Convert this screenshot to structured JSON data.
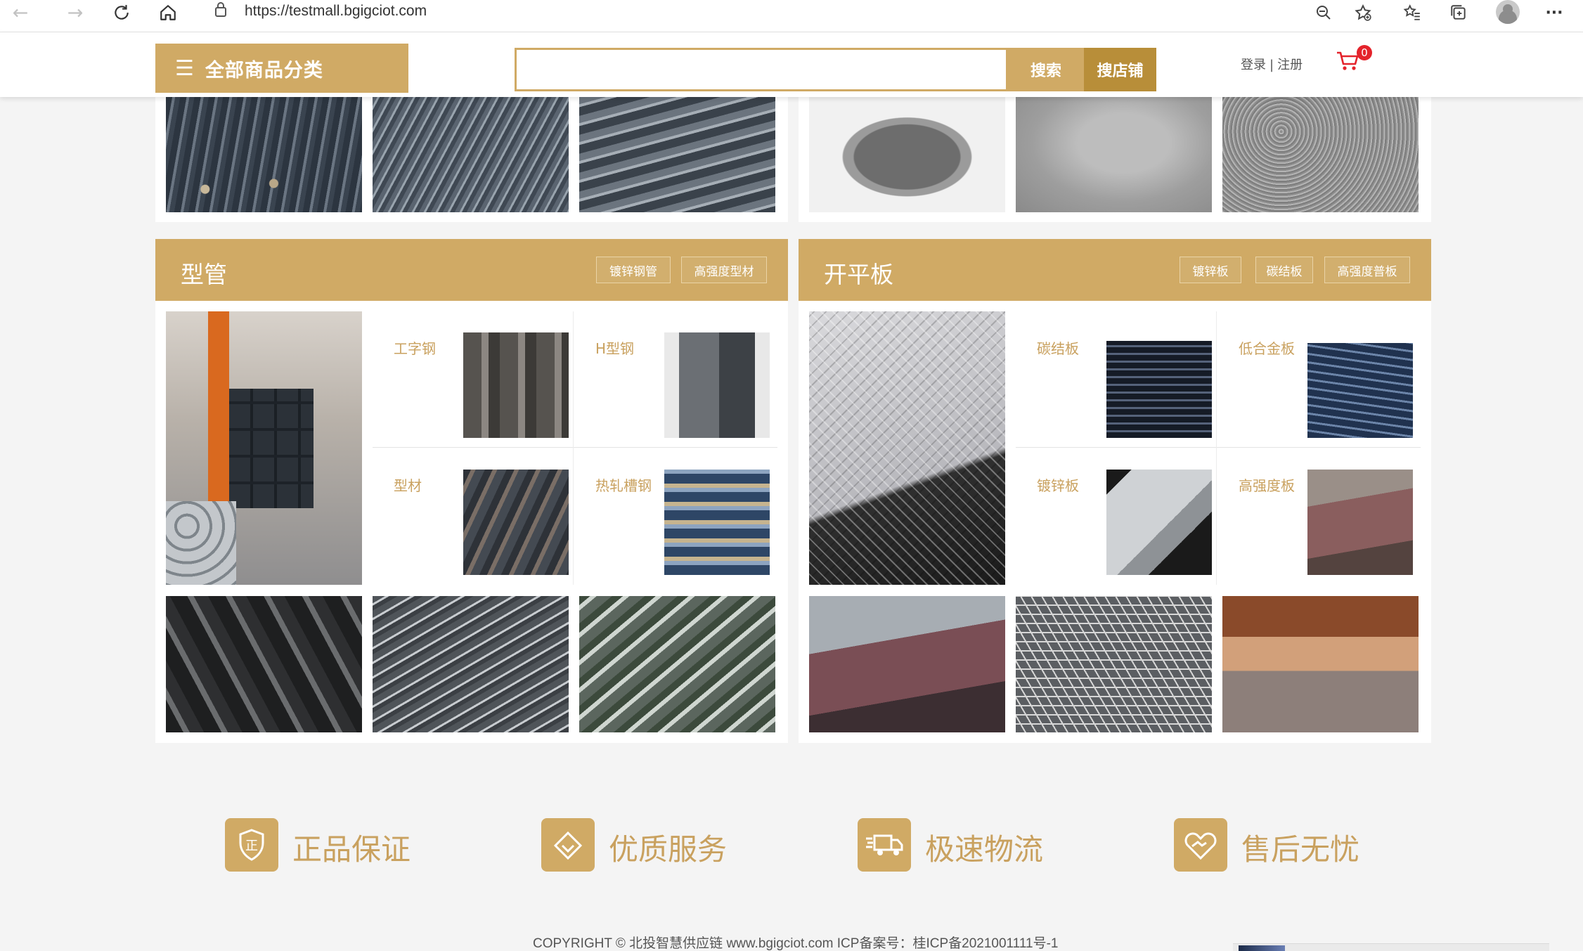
{
  "browser": {
    "url": "https://testmall.bgigciot.com",
    "icons": [
      "back-icon",
      "forward-icon",
      "refresh-icon",
      "home-icon",
      "lock-icon",
      "zoom-out-icon",
      "add-favorite-icon",
      "favorites-icon",
      "collections-icon",
      "profile-icon",
      "more-icon"
    ],
    "more_glyph": "···"
  },
  "header": {
    "all_categories": "全部商品分类",
    "search_placeholder": "",
    "search_button": "搜索",
    "search_shop_button": "搜店铺",
    "login": "登录",
    "divider": "|",
    "register": "注册",
    "cart_count": "0"
  },
  "sections": {
    "profile_tube": {
      "title": "型管",
      "tags": [
        "镀锌钢管",
        "高强度型材"
      ],
      "items": [
        "工字钢",
        "H型钢",
        "型材",
        "热轧槽钢"
      ]
    },
    "flat_plate": {
      "title": "开平板",
      "tags": [
        "镀锌板",
        "碳结板",
        "高强度普板"
      ],
      "items": [
        "碳结板",
        "低合金板",
        "镀锌板",
        "高强度板"
      ]
    }
  },
  "features": [
    {
      "label": "正品保证",
      "icon": "certificate-icon"
    },
    {
      "label": "优质服务",
      "icon": "diamond-icon"
    },
    {
      "label": "极速物流",
      "icon": "truck-icon"
    },
    {
      "label": "售后无忧",
      "icon": "handshake-heart-icon"
    }
  ],
  "footer": {
    "copyright": "COPYRIGHT © 北投智慧供应链 www.bgigciot.com  ICP备案号：桂ICP备2021001111号-1"
  },
  "colors": {
    "accent": "#d0aa65",
    "accent_dark": "#b88e39",
    "label_text": "#c9a15f",
    "cart_badge": "#e4232b",
    "cart_icon": "#e4232b"
  }
}
